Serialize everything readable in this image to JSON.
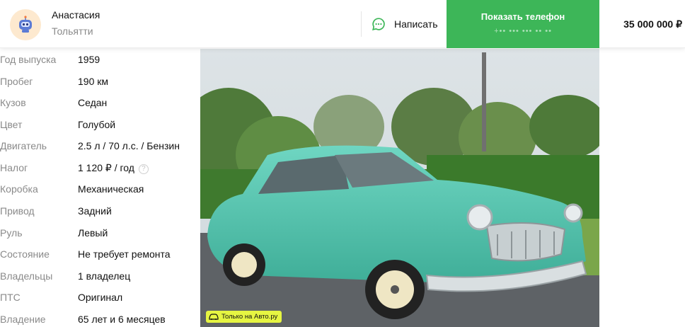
{
  "seller": {
    "name": "Анастасия",
    "city": "Тольятти"
  },
  "actions": {
    "write_label": "Написать",
    "phone_label": "Показать телефон",
    "phone_masked": "+•• ••• ••• •• ••"
  },
  "price": "35 000 000 ₽",
  "specs": [
    {
      "label": "Год выпуска",
      "value": "1959"
    },
    {
      "label": "Пробег",
      "value": "190 км"
    },
    {
      "label": "Кузов",
      "value": "Седан"
    },
    {
      "label": "Цвет",
      "value": "Голубой"
    },
    {
      "label": "Двигатель",
      "value": "2.5 л / 70 л.с. / Бензин"
    },
    {
      "label": "Налог",
      "value": "1 120 ₽ / год"
    },
    {
      "label": "Коробка",
      "value": "Механическая"
    },
    {
      "label": "Привод",
      "value": "Задний"
    },
    {
      "label": "Руль",
      "value": "Левый"
    },
    {
      "label": "Состояние",
      "value": "Не требует ремонта"
    },
    {
      "label": "Владельцы",
      "value": "1 владелец"
    },
    {
      "label": "ПТС",
      "value": "Оригинал"
    },
    {
      "label": "Владение",
      "value": "65 лет и 6 месяцев"
    }
  ],
  "photo": {
    "badge": "Только на Авто.ру"
  },
  "colors": {
    "accent_green": "#3db658",
    "badge_yellow": "#e6f542",
    "car_body": "#4fc4ad"
  },
  "icons": {
    "chat": "chat-bubble-icon",
    "help": "question-circle-icon",
    "badge": "car-icon"
  }
}
